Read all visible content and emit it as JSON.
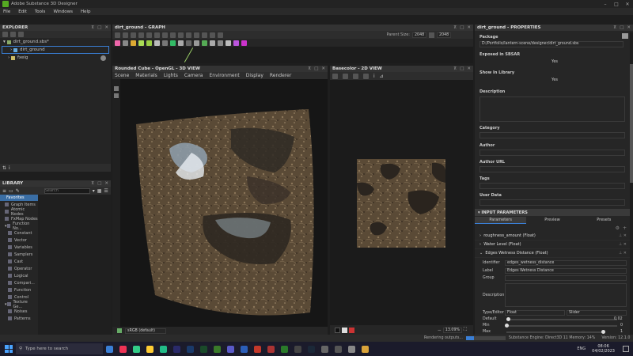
{
  "window": {
    "title": "Adobe Substance 3D Designer"
  },
  "menu": [
    "File",
    "Edit",
    "Tools",
    "Windows",
    "Help"
  ],
  "explorer": {
    "title": "EXPLORER",
    "package": "dirt_ground.sbs*",
    "graph": "dirt_ground",
    "folder": "fxeig"
  },
  "graph": {
    "title": "dirt_ground - GRAPH",
    "parent_size_label": "Parent Size:",
    "parent_size": "2048",
    "size2": "2048"
  },
  "view3d": {
    "title": "Rounded Cube - OpenGL - 3D VIEW",
    "menu": [
      "Scene",
      "Materials",
      "Lights",
      "Camera",
      "Environment",
      "Display",
      "Renderer"
    ],
    "colorspace": "sRGB (default)"
  },
  "view2d": {
    "title": "Basecolor - 2D VIEW",
    "zoom": "13.09%"
  },
  "library": {
    "title": "LIBRARY",
    "search_placeholder": "Search",
    "categories": [
      "Favorites",
      "Graph Items",
      "Atomic Nodes",
      "FxMap Nodes",
      "Function No...",
      "Constant",
      "Vector",
      "Variables",
      "Samplers",
      "Cast",
      "Operator",
      "Logical",
      "Compari...",
      "Function",
      "Control",
      "Texture Ge...",
      "Noises",
      "Patterns"
    ]
  },
  "properties": {
    "title": "dirt_ground - PROPERTIES",
    "package_label": "Package",
    "package_path": "D:/Portfolio/lantern-scene/designer/dirt_ground.sbs",
    "exposed_label": "Exposed in SBSAR",
    "exposed_value": "Yes",
    "show_label": "Show In Library",
    "show_value": "Yes",
    "description_label": "Description",
    "category_label": "Category",
    "author_label": "Author",
    "author_url_label": "Author URL",
    "tags_label": "Tags",
    "user_data_label": "User Data",
    "input_params_title": "INPUT PARAMETERS",
    "tabs": [
      "Parameters",
      "Preview",
      "Presets"
    ],
    "params": [
      "roughness_amount (Float)",
      "Water Level (Float)",
      "Edges Wetness Distance (Float)"
    ],
    "identifier_label": "Identifier",
    "identifier_value": "edges_wetness_distance",
    "label_label": "Label",
    "label_value": "Edges Wetness Distance",
    "group_label": "Group",
    "desc2_label": "Description",
    "type_label": "Type/Editor",
    "type_value": "Float",
    "editor_value": "Slider",
    "default_label": "Default",
    "default_value": "0.02",
    "min_label": "Min",
    "min_value": "0",
    "max_label": "Max",
    "max_value": "1"
  },
  "statusbar": {
    "rendering": "Rendering outputs...",
    "engine": "Substance Engine: Direct3D 11  Memory: 14%",
    "version": "Version: 12.1.0"
  },
  "taskbar": {
    "search": "Type here to search",
    "lang": "ENG",
    "time": "08:06",
    "date": "04/02/2023"
  }
}
